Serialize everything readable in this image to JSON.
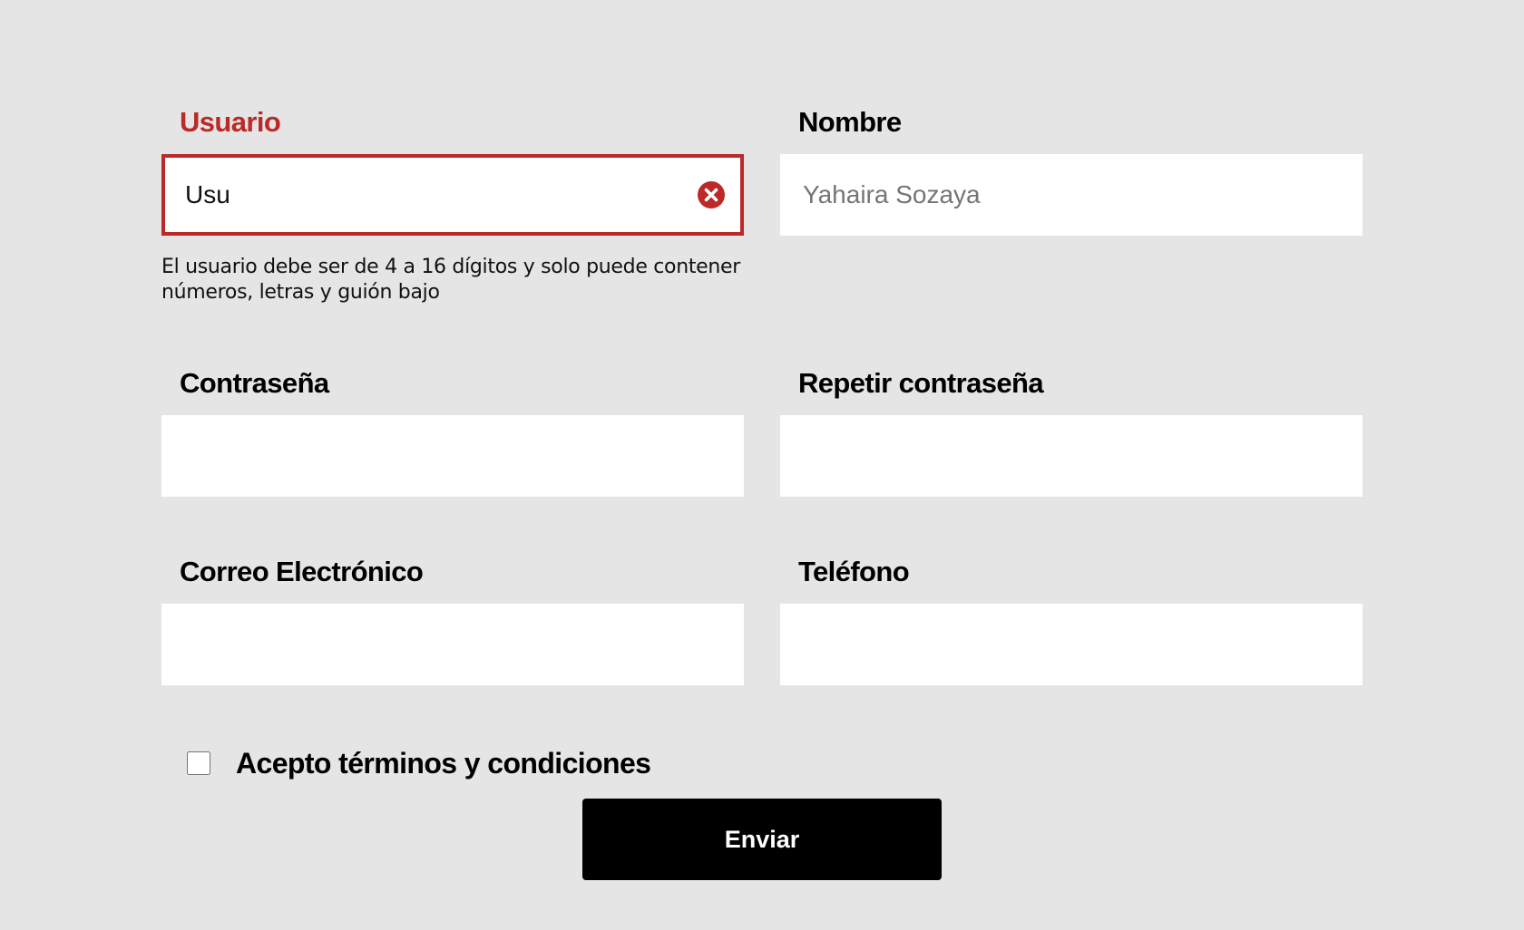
{
  "form": {
    "usuario": {
      "label": "Usuario",
      "value": "Usu",
      "placeholder": "",
      "error_message": "El usuario debe ser de 4 a 16 dígitos y solo puede contener números, letras y guión bajo",
      "clear_icon": "close-circle-icon",
      "state": "error"
    },
    "nombre": {
      "label": "Nombre",
      "value": "",
      "placeholder": "Yahaira Sozaya"
    },
    "password": {
      "label": "Contraseña",
      "value": "",
      "placeholder": ""
    },
    "password_repeat": {
      "label": "Repetir contraseña",
      "value": "",
      "placeholder": ""
    },
    "correo": {
      "label": "Correo Electrónico",
      "value": "",
      "placeholder": ""
    },
    "telefono": {
      "label": "Teléfono",
      "value": "",
      "placeholder": ""
    },
    "terms": {
      "label": "Acepto términos y condiciones",
      "checked": false
    },
    "submit_label": "Enviar"
  },
  "colors": {
    "background": "#e5e5e5",
    "error": "#bb2929",
    "input_background": "#ffffff",
    "button_background": "#000000",
    "button_text": "#ffffff"
  }
}
